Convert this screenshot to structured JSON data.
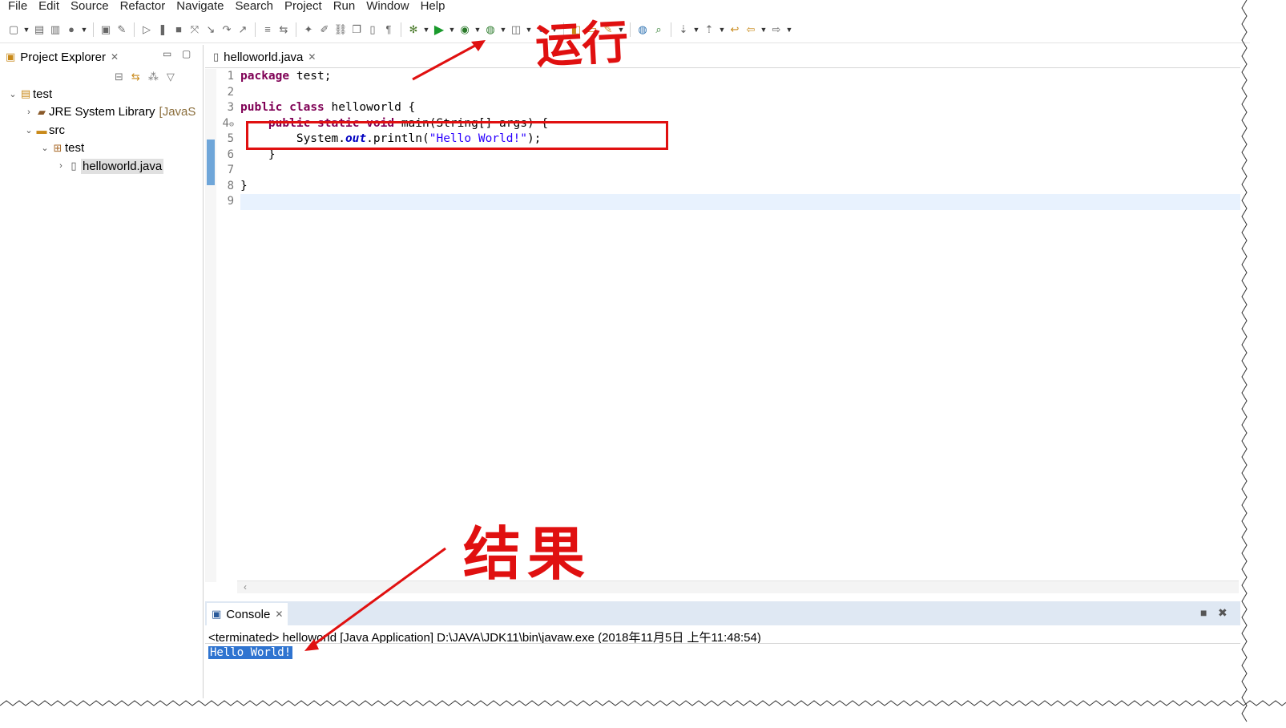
{
  "menubar": [
    "File",
    "Edit",
    "Source",
    "Refactor",
    "Navigate",
    "Search",
    "Project",
    "Run",
    "Window",
    "Help"
  ],
  "project_explorer": {
    "title": "Project Explorer",
    "tree": [
      {
        "label": "test",
        "suffix": "",
        "icon": "project-icon",
        "twisty": "v",
        "indent": 0
      },
      {
        "label": "JRE System Library",
        "suffix": "[JavaS",
        "icon": "library-icon",
        "twisty": ">",
        "indent": 1
      },
      {
        "label": "src",
        "suffix": "",
        "icon": "source-folder-icon",
        "twisty": "v",
        "indent": 1
      },
      {
        "label": "test",
        "suffix": "",
        "icon": "package-icon",
        "twisty": "v",
        "indent": 2
      },
      {
        "label": "helloworld.java",
        "suffix": "",
        "icon": "java-file-icon",
        "twisty": ">",
        "indent": 3,
        "selected": true
      }
    ]
  },
  "editor": {
    "tab_label": "helloworld.java",
    "line_numbers": [
      "1",
      "2",
      "3",
      "4",
      "5",
      "6",
      "7",
      "8",
      "9"
    ],
    "fold_marker": "⊖",
    "code": {
      "l1_kw": "package",
      "l1_rest": " test;",
      "l3_kw1": "public",
      "l3_kw2": "class",
      "l3_rest": " helloworld {",
      "l4_kw1": "public",
      "l4_kw2": "static",
      "l4_kw3": "void",
      "l4_rest": " main(String[] args) {",
      "l5_pre": "        System.",
      "l5_field": "out",
      "l5_mid": ".println(",
      "l5_str": "\"Hello World!\"",
      "l5_post": ");",
      "l6": "    }",
      "l8": "}"
    }
  },
  "console": {
    "tab_label": "Console",
    "terminated": "<terminated> helloworld [Java Application] D:\\JAVA\\JDK11\\bin\\javaw.exe (2018年11月5日 上午11:48:54)",
    "output": "Hello World!"
  },
  "annotations": {
    "run_label": "运行",
    "result_label": "结果",
    "color": "#e01010"
  }
}
